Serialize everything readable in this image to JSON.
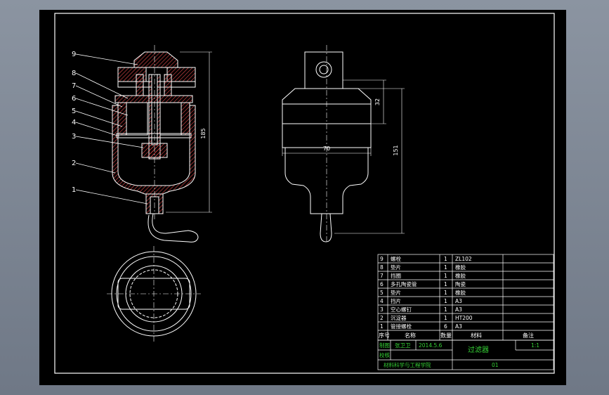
{
  "colors": {
    "background": "#7d8694",
    "sheet": "#000000",
    "line": "#ffffff",
    "hatch": "#e74c4c",
    "table_text": "#ffffff",
    "title_text": "#35d035",
    "dimension": "#ffffff"
  },
  "balloons": [
    "1",
    "2",
    "3",
    "4",
    "5",
    "6",
    "7",
    "8",
    "9"
  ],
  "dimensions": {
    "left_height": "185",
    "right_upper": "32",
    "right_width": "70",
    "right_height": "151"
  },
  "bom": {
    "rows": [
      {
        "no": "9",
        "name": "螺栓",
        "qty": "1",
        "material": "ZL102",
        "note": ""
      },
      {
        "no": "8",
        "name": "垫片",
        "qty": "1",
        "material": "橡胶",
        "note": ""
      },
      {
        "no": "7",
        "name": "挡圈",
        "qty": "1",
        "material": "橡胶",
        "note": ""
      },
      {
        "no": "6",
        "name": "多孔陶瓷管",
        "qty": "1",
        "material": "陶瓷",
        "note": ""
      },
      {
        "no": "5",
        "name": "垫片",
        "qty": "1",
        "material": "橡胶",
        "note": ""
      },
      {
        "no": "4",
        "name": "挡片",
        "qty": "1",
        "material": "A3",
        "note": ""
      },
      {
        "no": "3",
        "name": "空心螺钉",
        "qty": "1",
        "material": "A3",
        "note": ""
      },
      {
        "no": "2",
        "name": "沉淀器",
        "qty": "1",
        "material": "HT200",
        "note": ""
      },
      {
        "no": "1",
        "name": "管接螺栓",
        "qty": "6",
        "material": "A3",
        "note": ""
      }
    ],
    "header": {
      "no": "序号",
      "name": "名称",
      "qty": "数量",
      "material": "材料",
      "note": "备注"
    }
  },
  "title_block": {
    "draw_label": "制图",
    "drafter": "张卫卫",
    "date": "2014.5.6",
    "title": "过滤器",
    "scale": "1:1",
    "check_label": "校核",
    "school": "材料科学与工程学院",
    "drawing_no": "01"
  }
}
